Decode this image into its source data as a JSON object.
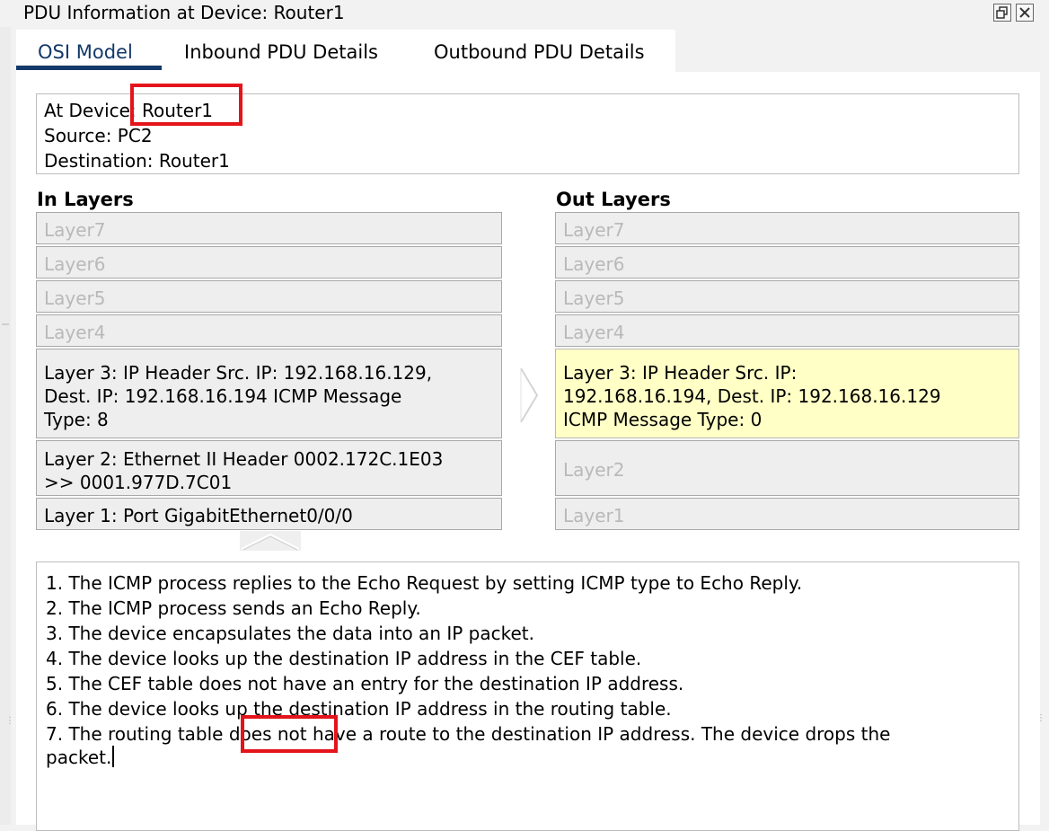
{
  "window": {
    "title": "PDU Information at Device: Router1",
    "restore_icon": "restore-window-icon",
    "close_icon": "close-window-icon"
  },
  "tabs": [
    {
      "label": "OSI Model",
      "active": true
    },
    {
      "label": "Inbound PDU Details",
      "active": false
    },
    {
      "label": "Outbound PDU Details",
      "active": false
    }
  ],
  "info": {
    "at_device_prefix": "At Devic",
    "at_device_rest": "e: Router1",
    "source": "Source: PC2",
    "destination": "Destination: Router1"
  },
  "in_layers": {
    "heading": "In Layers",
    "items": [
      {
        "text": "Layer7",
        "enabled": false
      },
      {
        "text": "Layer6",
        "enabled": false
      },
      {
        "text": "Layer5",
        "enabled": false
      },
      {
        "text": "Layer4",
        "enabled": false
      },
      {
        "line1": "Layer 3: IP Header Src. IP: 192.168.16.129,",
        "line2": "Dest. IP: 192.168.16.194 ICMP Message",
        "line3": "Type: 8",
        "enabled": true
      },
      {
        "line1": "Layer 2: Ethernet II Header 0002.172C.1E03",
        "line2": ">> 0001.977D.7C01",
        "enabled": true
      },
      {
        "text": "Layer 1: Port GigabitEthernet0/0/0",
        "enabled": true
      }
    ]
  },
  "out_layers": {
    "heading": "Out Layers",
    "items": [
      {
        "text": "Layer7",
        "enabled": false
      },
      {
        "text": "Layer6",
        "enabled": false
      },
      {
        "text": "Layer5",
        "enabled": false
      },
      {
        "text": "Layer4",
        "enabled": false
      },
      {
        "line1": "Layer 3: IP Header Src. IP:",
        "line2": "192.168.16.194, Dest. IP: 192.168.16.129",
        "line3": "ICMP Message Type: 0",
        "enabled": true,
        "selected": true
      },
      {
        "text": "Layer2",
        "enabled": false
      },
      {
        "text": "Layer1",
        "enabled": false
      }
    ]
  },
  "steps": [
    "1. The ICMP process replies to the Echo Request by setting ICMP type to Echo Reply.",
    "2. The ICMP process sends an Echo Reply.",
    "3. The device encapsulates the data into an IP packet.",
    "4. The device looks up the destination IP address in the CEF table.",
    "5. The CEF table does not have an entry for the destination IP address.",
    "6. The device looks up the destination IP address in the routing table.",
    "7. The routing table does not have a route to the destination IP address. The device drops the",
    "packet."
  ],
  "colors": {
    "tab_accent": "#14396a",
    "highlight_box": "#e4141b",
    "selected_layer": "#ffffc6"
  }
}
